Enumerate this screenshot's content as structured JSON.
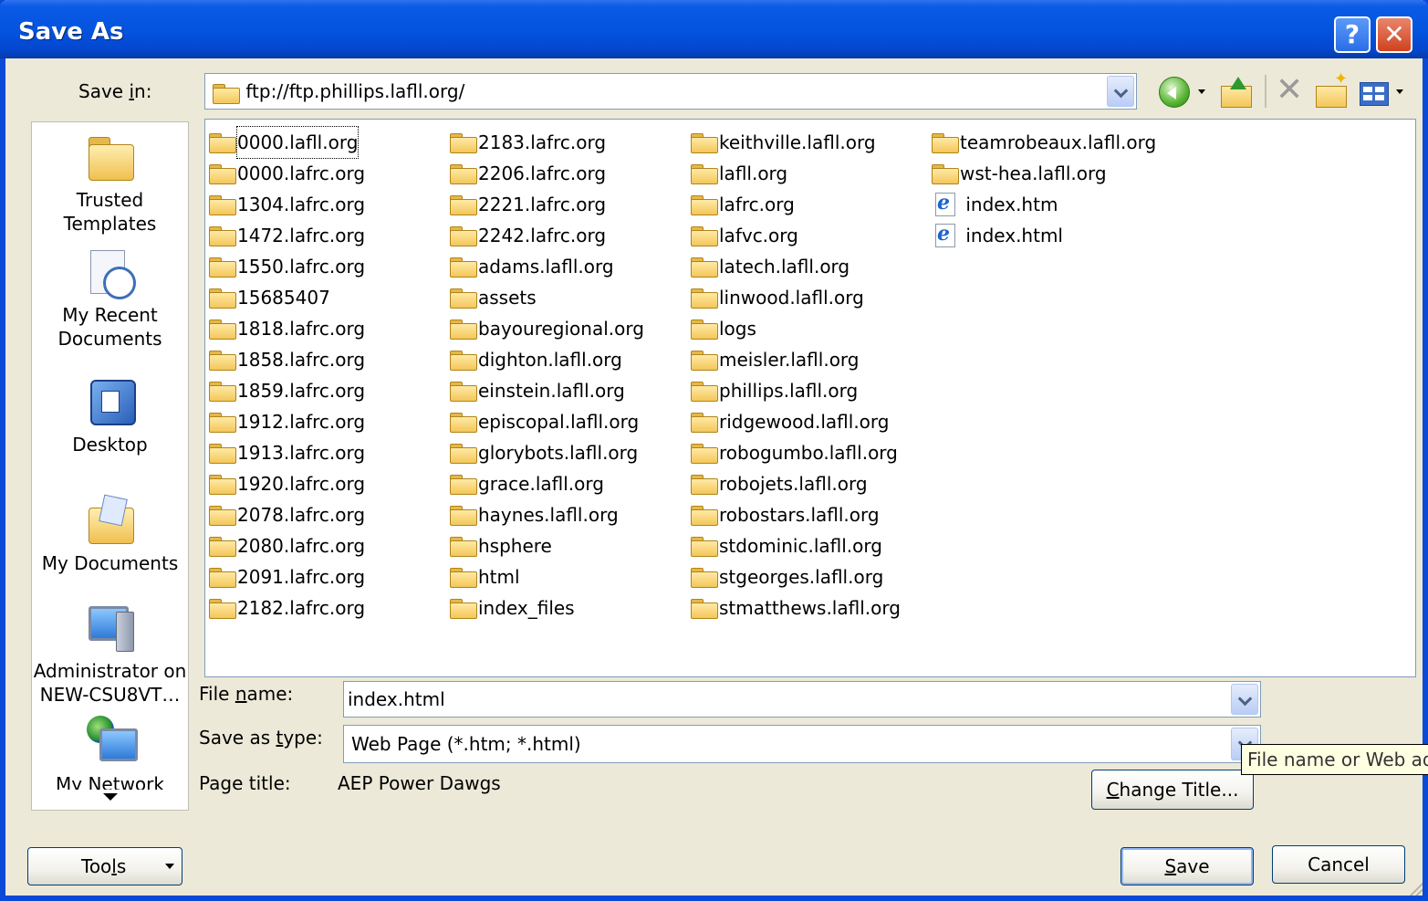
{
  "window": {
    "title": "Save As",
    "help_glyph": "?",
    "close_glyph": "✕"
  },
  "save_in": {
    "label_pre": "Save ",
    "label_u": "i",
    "label_post": "n:",
    "value": "ftp://ftp.phillips.lafll.org/"
  },
  "toolbar": {
    "icons": [
      "back-icon",
      "up-one-level-icon",
      "delete-icon",
      "new-folder-icon",
      "views-icon"
    ],
    "delete_glyph": "✕"
  },
  "places": [
    {
      "line1": "Trusted",
      "line2": "Templates",
      "icon": "trusted-templates-folder-icon"
    },
    {
      "line1": "My Recent",
      "line2": "Documents",
      "icon": "recent-documents-icon"
    },
    {
      "line1": "Desktop",
      "line2": "",
      "icon": "desktop-icon"
    },
    {
      "line1": "My Documents",
      "line2": "",
      "icon": "my-documents-icon"
    },
    {
      "line1": "Administrator on",
      "line2": "NEW-CSU8VT…",
      "icon": "computer-icon"
    },
    {
      "line1": "My Network",
      "line2": "",
      "icon": "network-places-icon"
    }
  ],
  "files": {
    "columns": [
      [
        "0000.lafll.org",
        "0000.lafrc.org",
        "1304.lafrc.org",
        "1472.lafrc.org",
        "1550.lafrc.org",
        "15685407",
        "1818.lafrc.org",
        "1858.lafrc.org",
        "1859.lafrc.org",
        "1912.lafrc.org",
        "1913.lafrc.org",
        "1920.lafrc.org",
        "2078.lafrc.org",
        "2080.lafrc.org",
        "2091.lafrc.org",
        "2182.lafrc.org"
      ],
      [
        "2183.lafrc.org",
        "2206.lafrc.org",
        "2221.lafrc.org",
        "2242.lafrc.org",
        "adams.lafll.org",
        "assets",
        "bayouregional.org",
        "dighton.lafll.org",
        "einstein.lafll.org",
        "episcopal.lafll.org",
        "glorybots.lafll.org",
        "grace.lafll.org",
        "haynes.lafll.org",
        "hsphere",
        "html",
        "index_files"
      ],
      [
        "keithville.lafll.org",
        "lafll.org",
        "lafrc.org",
        "lafvc.org",
        "latech.lafll.org",
        "linwood.lafll.org",
        "logs",
        "meisler.lafll.org",
        "phillips.lafll.org",
        "ridgewood.lafll.org",
        "robogumbo.lafll.org",
        "robojets.lafll.org",
        "robostars.lafll.org",
        "stdominic.lafll.org",
        "stgeorges.lafll.org",
        "stmatthews.lafll.org"
      ],
      [
        "teamrobeaux.lafll.org",
        "wst-hea.lafll.org"
      ]
    ],
    "html_files": [
      "index.htm",
      "index.html"
    ],
    "selected": "0000.lafll.org"
  },
  "file_name": {
    "label_pre": "File ",
    "label_u": "n",
    "label_post": "ame:",
    "value": "index.html"
  },
  "save_as_type": {
    "label_pre": "Save as ",
    "label_u": "t",
    "label_post": "ype:",
    "value": "Web Page (*.htm; *.html)"
  },
  "page_title": {
    "label": "Page title:",
    "value": "AEP Power Dawgs"
  },
  "buttons": {
    "change_title_u": "C",
    "change_title_rest": "hange Title...",
    "tools_pre": "Too",
    "tools_u": "l",
    "tools_post": "s",
    "save_u": "S",
    "save_rest": "ave",
    "cancel": "Cancel"
  },
  "tooltip": "File name or Web address"
}
